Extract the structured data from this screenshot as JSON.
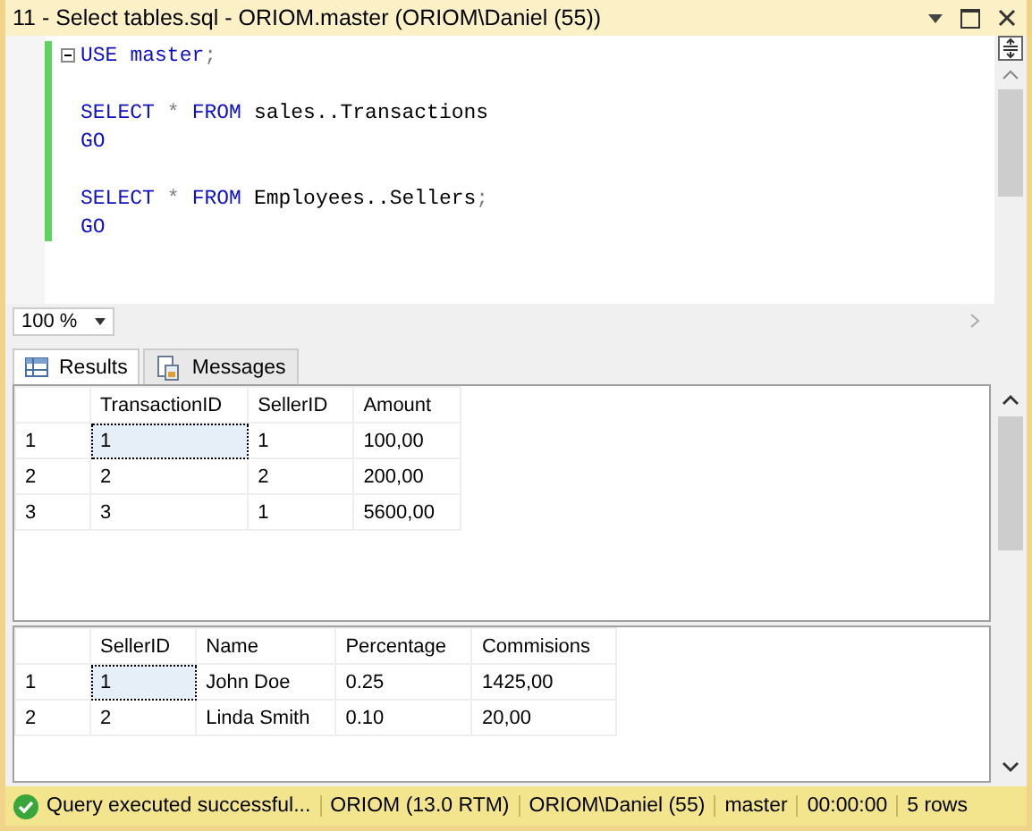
{
  "window": {
    "title": "11 - Select tables.sql - ORIOM.master (ORIOM\\Daniel (55))"
  },
  "editor": {
    "lines": [
      {
        "kind": "code",
        "tokens": [
          {
            "kind": "keyword",
            "text": "USE"
          },
          {
            "kind": "keyword",
            "text": "master"
          },
          {
            "kind": "terminator",
            "text": ";"
          }
        ]
      },
      {
        "kind": "blank"
      },
      {
        "kind": "code",
        "tokens": [
          {
            "kind": "keyword",
            "text": "SELECT"
          },
          {
            "kind": "punct",
            "text": "*"
          },
          {
            "kind": "keyword",
            "text": "FROM"
          },
          {
            "kind": "ident",
            "text": "sales..Transactions"
          }
        ]
      },
      {
        "kind": "code",
        "tokens": [
          {
            "kind": "keyword",
            "text": "GO"
          }
        ]
      },
      {
        "kind": "blank"
      },
      {
        "kind": "code",
        "tokens": [
          {
            "kind": "keyword",
            "text": "SELECT"
          },
          {
            "kind": "punct",
            "text": "*"
          },
          {
            "kind": "keyword",
            "text": "FROM"
          },
          {
            "kind": "ident",
            "text": "Employees..Sellers"
          },
          {
            "kind": "terminator",
            "text": ";"
          }
        ]
      },
      {
        "kind": "code",
        "tokens": [
          {
            "kind": "keyword",
            "text": "GO"
          }
        ]
      }
    ]
  },
  "zoom": {
    "value": "100 %"
  },
  "tabs": [
    {
      "label": "Results",
      "selected": true
    },
    {
      "label": "Messages",
      "selected": false
    }
  ],
  "grids": [
    {
      "columns": [
        "TransactionID",
        "SellerID",
        "Amount"
      ],
      "rows": [
        {
          "number": "1",
          "selected": true,
          "cells": [
            "1",
            "1",
            "100,00"
          ]
        },
        {
          "number": "2",
          "selected": false,
          "cells": [
            "2",
            "2",
            "200,00"
          ]
        },
        {
          "number": "3",
          "selected": false,
          "cells": [
            "3",
            "1",
            "5600,00"
          ]
        }
      ]
    },
    {
      "columns": [
        "SellerID",
        "Name",
        "Percentage",
        "Commisions"
      ],
      "rows": [
        {
          "number": "1",
          "selected": true,
          "cells": [
            "1",
            "John Doe",
            "0.25",
            "1425,00"
          ]
        },
        {
          "number": "2",
          "selected": false,
          "cells": [
            "2",
            "Linda Smith",
            "0.10",
            "20,00"
          ]
        }
      ]
    }
  ],
  "status_bar": [
    {
      "kind": "status",
      "text": "Query executed successful..."
    },
    {
      "kind": "plain",
      "text": "ORIOM (13.0 RTM)"
    },
    {
      "kind": "plain",
      "text": "ORIOM\\Daniel (55)"
    },
    {
      "kind": "plain",
      "text": "master"
    },
    {
      "kind": "plain",
      "text": "00:00:00"
    },
    {
      "kind": "plain",
      "text": "5 rows"
    }
  ]
}
